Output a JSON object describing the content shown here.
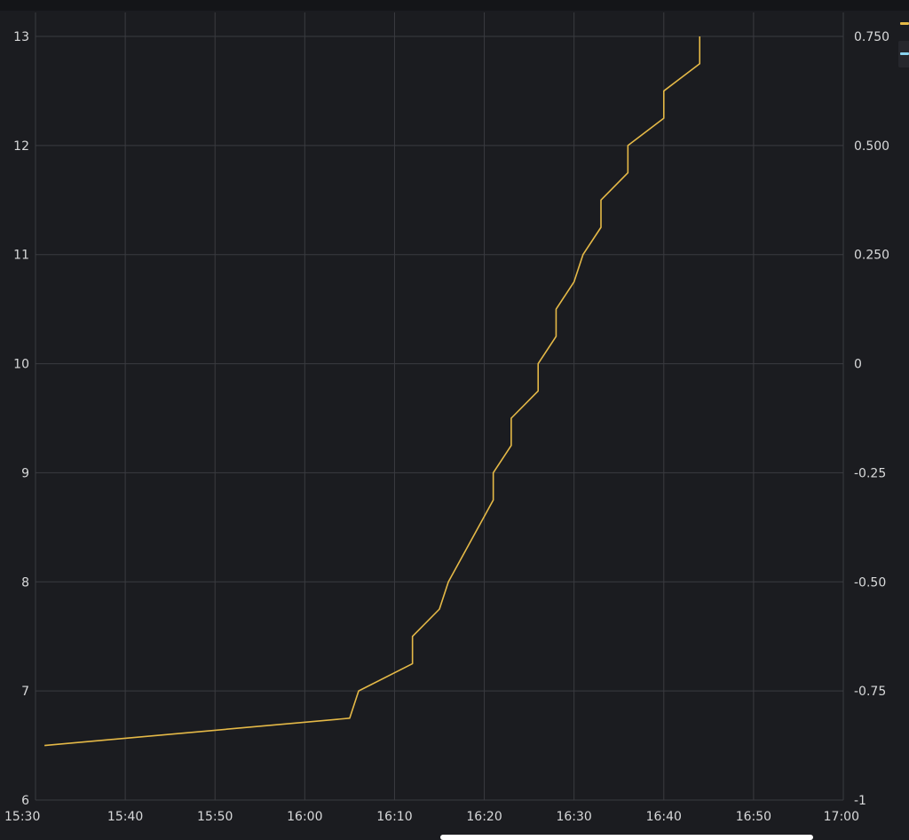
{
  "colors": {
    "background": "#1b1c20",
    "grid": "#3a3b40",
    "text": "#d8d9da",
    "series_primary": "#e5b947",
    "series_secondary": "#8ad3ee"
  },
  "legend": {
    "items": [
      {
        "icon": "legend-swatch-yellow",
        "color": "#e5b947"
      },
      {
        "icon": "legend-swatch-blue",
        "color": "#8ad3ee"
      }
    ]
  },
  "chart_data": {
    "type": "line",
    "title": "",
    "xlabel": "",
    "ylabel": "",
    "grid": true,
    "x_ticks": [
      "15:30",
      "15:40",
      "15:50",
      "16:00",
      "16:10",
      "16:20",
      "16:30",
      "16:40",
      "16:50",
      "17:00"
    ],
    "xlim": [
      "15:30",
      "17:00"
    ],
    "y_left_ticks": [
      "6",
      "7",
      "8",
      "9",
      "10",
      "11",
      "12",
      "13"
    ],
    "ylim_left": [
      6,
      13
    ],
    "y_right_ticks": [
      "-1",
      "-0.75",
      "-0.50",
      "-0.25",
      "0",
      "0.250",
      "0.500",
      "0.750"
    ],
    "ylim_right": [
      -1,
      0.75
    ],
    "series": [
      {
        "axis": "left",
        "color": "#e5b947",
        "points": [
          [
            "15:31",
            6.5
          ],
          [
            "16:05",
            6.75
          ],
          [
            "16:06",
            7.0
          ],
          [
            "16:12",
            7.25
          ],
          [
            "16:12",
            7.5
          ],
          [
            "16:15",
            7.75
          ],
          [
            "16:16",
            8.0
          ],
          [
            "16:21",
            8.75
          ],
          [
            "16:21",
            9.0
          ],
          [
            "16:23",
            9.25
          ],
          [
            "16:23",
            9.5
          ],
          [
            "16:26",
            9.75
          ],
          [
            "16:26",
            10.0
          ],
          [
            "16:28",
            10.25
          ],
          [
            "16:28",
            10.5
          ],
          [
            "16:30",
            10.75
          ],
          [
            "16:31",
            11.0
          ],
          [
            "16:33",
            11.25
          ],
          [
            "16:33",
            11.5
          ],
          [
            "16:36",
            11.75
          ],
          [
            "16:36",
            12.0
          ],
          [
            "16:40",
            12.25
          ],
          [
            "16:40",
            12.5
          ],
          [
            "16:44",
            12.75
          ],
          [
            "16:44",
            13.0
          ]
        ]
      }
    ]
  }
}
